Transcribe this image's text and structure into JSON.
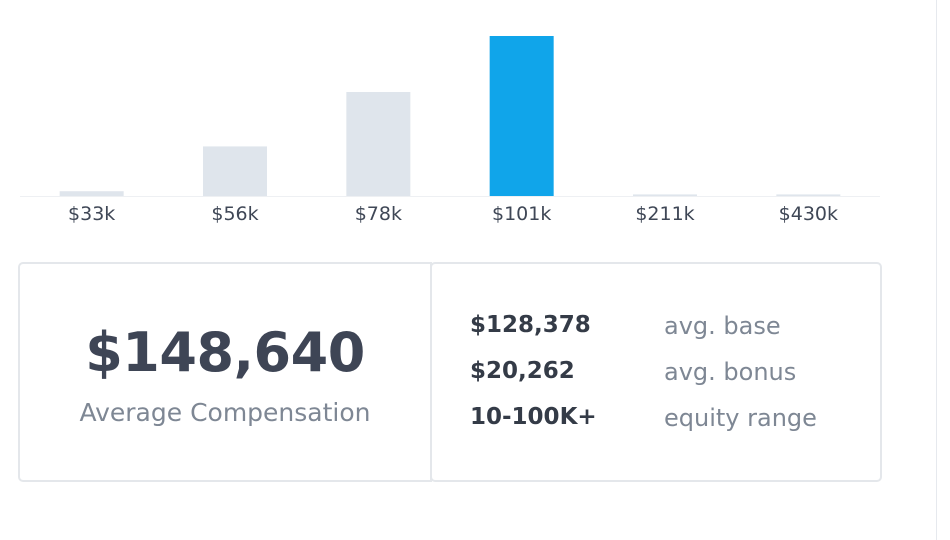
{
  "chart_data": {
    "type": "bar",
    "categories": [
      "$33k",
      "$56k",
      "$78k",
      "$101k",
      "$211k",
      "$430k"
    ],
    "values": [
      3,
      31,
      65,
      100,
      1,
      1
    ],
    "highlight_index": 3,
    "ylim": [
      0,
      100
    ],
    "colors": {
      "bar": "#dfe5ec",
      "highlight": "#10a5ea",
      "baseline": "#eef0f3",
      "tick_label": "#3f4756"
    }
  },
  "summary": {
    "average_value": "$148,640",
    "average_label": "Average Compensation"
  },
  "breakdown": [
    {
      "value": "$128,378",
      "label": "avg. base"
    },
    {
      "value": "$20,262",
      "label": "avg. bonus"
    },
    {
      "value": "10-100K+",
      "label": "equity range"
    }
  ]
}
